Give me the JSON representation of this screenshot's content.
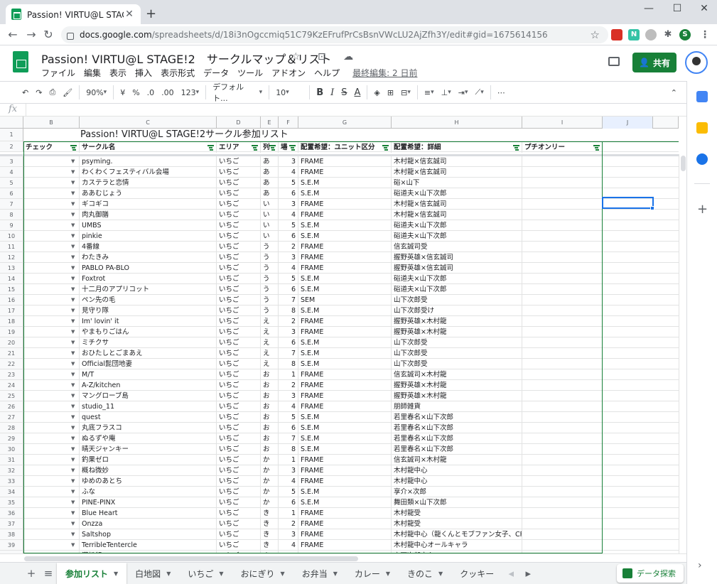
{
  "browser": {
    "tab_title": "Passion! VIRTU@L STAGE!2　サー",
    "tab_close": "✕",
    "new_tab": "+",
    "url_host": "docs.google.com",
    "url_path": "/spreadsheets/d/18i3nOgccmiq51C79KzEFrufPrCsBsnVWcLU2AjZfh3Y/edit#gid=1675614156",
    "back": "←",
    "forward": "→",
    "reload": "↻",
    "minimize": "—",
    "maximize": "☐",
    "close": "✕",
    "star": "☆",
    "menu": "⋮",
    "profile_letter": "S"
  },
  "doc": {
    "title": "Passion! VIRTU@L STAGE!2　サークルマップ＆リスト",
    "title_icons": "☆ ⊡ ☁",
    "menus": [
      "ファイル",
      "編集",
      "表示",
      "挿入",
      "表示形式",
      "データ",
      "ツール",
      "アドオン",
      "ヘルプ"
    ],
    "last_edit": "最終編集: 2 日前",
    "share_label": "共有"
  },
  "format_toolbar": {
    "undo": "↶",
    "redo": "↷",
    "print": "⎙",
    "paint": "🖌",
    "zoom": "90%",
    "currency": "¥",
    "percent": "%",
    "dec_minus": ".0",
    "dec_plus": ".00",
    "more_formats": "123",
    "font": "デフォルト...",
    "font_size": "10",
    "bold": "B",
    "italic": "I",
    "strike": "S",
    "text_color": "A",
    "fill": "◈",
    "borders": "⊞",
    "merge": "⊟",
    "halign": "≡",
    "valign": "⊥",
    "wrap": "⇥",
    "rotate": "⟋",
    "more": "⋯",
    "collapse": "⌃"
  },
  "formula_bar": {
    "fx": "fx",
    "value": ""
  },
  "columns": [
    "",
    "B",
    "C",
    "D",
    "E",
    "F",
    "G",
    "H",
    "I",
    "J"
  ],
  "sheet": {
    "title": "Passion! VIRTU@L STAGE!2サークル参加リスト",
    "headers": [
      "チェック",
      "サークル名",
      "エリア",
      "列",
      "場",
      "配置希望：ユニット区分",
      "配置希望：詳細",
      "プチオンリー"
    ],
    "rows": [
      [
        "3",
        "psyming.",
        "いちご",
        "あ",
        "3",
        "FRAME",
        "木村龍×信玄誠司"
      ],
      [
        "4",
        "わくわくフェスティバル会場",
        "いちご",
        "あ",
        "4",
        "FRAME",
        "木村龍×信玄誠司"
      ],
      [
        "5",
        "カステラと恋情",
        "いちご",
        "あ",
        "5",
        "S.E.M",
        "硲×山下"
      ],
      [
        "6",
        "ああむじょう",
        "いちご",
        "あ",
        "6",
        "S.E.M",
        "硲道夫×山下次郎"
      ],
      [
        "7",
        "ギコギコ",
        "いちご",
        "い",
        "3",
        "FRAME",
        "木村龍×信玄誠司"
      ],
      [
        "8",
        "肉丸御膳",
        "いちご",
        "い",
        "4",
        "FRAME",
        "木村龍×信玄誠司"
      ],
      [
        "9",
        "UMBS",
        "いちご",
        "い",
        "5",
        "S.E.M",
        "硲道夫×山下次郎"
      ],
      [
        "10",
        "pinkie",
        "いちご",
        "い",
        "6",
        "S.E.M",
        "硲道夫×山下次郎"
      ],
      [
        "11",
        "4番線",
        "いちご",
        "う",
        "2",
        "FRAME",
        "信玄誠司受"
      ],
      [
        "12",
        "わたきみ",
        "いちご",
        "う",
        "3",
        "FRAME",
        "握野英雄×信玄誠司"
      ],
      [
        "13",
        "PABLO PA-BLO",
        "いちご",
        "う",
        "4",
        "FRAME",
        "握野英雄×信玄誠司"
      ],
      [
        "14",
        "Foxtrot",
        "いちご",
        "う",
        "5",
        "S.E.M",
        "硲道夫×山下次郎"
      ],
      [
        "15",
        "十二月のアプリコット",
        "いちご",
        "う",
        "6",
        "S.E.M",
        "硲道夫×山下次郎"
      ],
      [
        "16",
        "ペン先の毛",
        "いちご",
        "う",
        "7",
        "SEM",
        "山下次郎受"
      ],
      [
        "17",
        "見守り隊",
        "いちご",
        "う",
        "8",
        "S.E.M",
        "山下次郎受け"
      ],
      [
        "18",
        "Im' lovin' it",
        "いちご",
        "え",
        "2",
        "FRAME",
        "握野英雄×木村龍"
      ],
      [
        "19",
        "やまもりごはん",
        "いちご",
        "え",
        "3",
        "FRAME",
        "握野英雄×木村龍"
      ],
      [
        "20",
        "ミチクサ",
        "いちご",
        "え",
        "6",
        "S.E.M",
        "山下次郎受"
      ],
      [
        "21",
        "おひたしとごまあえ",
        "いちご",
        "え",
        "7",
        "S.E.M",
        "山下次郎受"
      ],
      [
        "22",
        "Official髭団地妻",
        "いちご",
        "え",
        "8",
        "S.E.M",
        "山下次郎受"
      ],
      [
        "23",
        "M/T",
        "いちご",
        "お",
        "1",
        "FRAME",
        "信玄誠司×木村龍"
      ],
      [
        "24",
        "A-Z/kitchen",
        "いちご",
        "お",
        "2",
        "FRAME",
        "握野英雄×木村龍"
      ],
      [
        "25",
        "マングローブ島",
        "いちご",
        "お",
        "3",
        "FRAME",
        "握野英雄×木村龍"
      ],
      [
        "26",
        "studio_11",
        "いちご",
        "お",
        "4",
        "FRAME",
        "朋師雑貨"
      ],
      [
        "27",
        "quest",
        "いちご",
        "お",
        "5",
        "S.E.M",
        "若里春名×山下次郎"
      ],
      [
        "28",
        "丸底フラスコ",
        "いちご",
        "お",
        "6",
        "S.E.M",
        "若里春名×山下次郎"
      ],
      [
        "29",
        "ぬるずや庵",
        "いちご",
        "お",
        "7",
        "S.E.M",
        "若里春名×山下次郎"
      ],
      [
        "30",
        "晴天ジャンキー",
        "いちご",
        "お",
        "8",
        "S.E.M",
        "若里春名×山下次郎"
      ],
      [
        "31",
        "釣果ゼロ",
        "いちご",
        "か",
        "1",
        "FRAME",
        "信玄誠司×木村龍"
      ],
      [
        "32",
        "概ね微妙",
        "いちご",
        "か",
        "3",
        "FRAME",
        "木村龍中心"
      ],
      [
        "33",
        "ゆめのあとち",
        "いちご",
        "か",
        "4",
        "FRAME",
        "木村龍中心"
      ],
      [
        "34",
        "ふな",
        "いちご",
        "か",
        "5",
        "S.E.M",
        "享介×次郎"
      ],
      [
        "35",
        "PINE-PINX",
        "いちご",
        "か",
        "6",
        "S.E.M",
        "舞田類×山下次郎"
      ],
      [
        "36",
        "Blue Heart",
        "いちご",
        "き",
        "1",
        "FRAME",
        "木村龍受"
      ],
      [
        "37",
        "Onzza",
        "いちご",
        "き",
        "2",
        "FRAME",
        "木村龍受"
      ],
      [
        "38",
        "Saltshop",
        "いちご",
        "き",
        "3",
        "FRAME",
        "木村龍中心（龍くんとモブファン女子、CP要素なし）"
      ],
      [
        "39",
        "TerribleTentercle",
        "いちご",
        "き",
        "4",
        "FRAME",
        "木村龍中心オールキャラ"
      ],
      [
        "40",
        "漢松鍋",
        "いちご",
        "き",
        "5",
        "S.E.M",
        "山下次郎中心"
      ]
    ]
  },
  "sheet_tabs": {
    "add": "+",
    "list": "≡",
    "tabs": [
      "参加リスト",
      "白地図",
      "いちご",
      "おにぎり",
      "お弁当",
      "カレー",
      "きのこ",
      "クッキー"
    ],
    "active_index": 0,
    "explore_label": "データ探索",
    "prev": "◂",
    "next": "▸"
  },
  "colors": {
    "green": "#188038",
    "sheets_green": "#0f9d58",
    "selection": "#1a73e8"
  }
}
